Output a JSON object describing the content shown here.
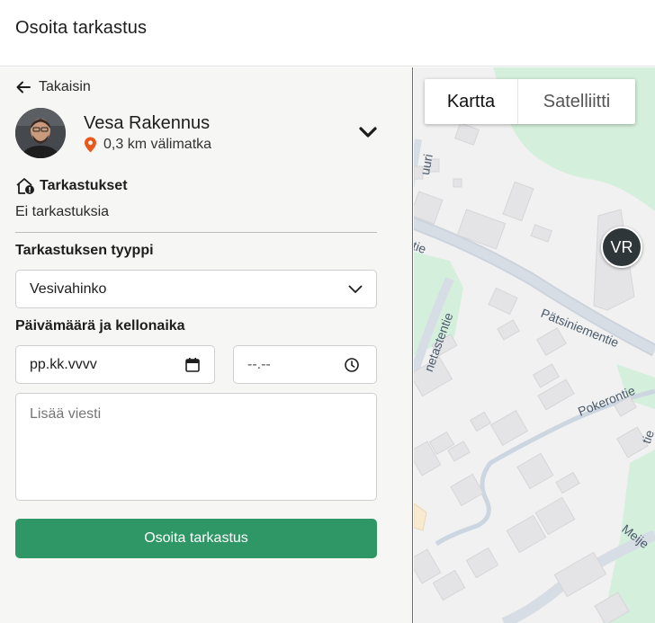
{
  "header": {
    "title": "Osoita tarkastus"
  },
  "back": {
    "label": "Takaisin"
  },
  "person": {
    "name": "Vesa Rakennus",
    "distance": "0,3 km välimatka"
  },
  "inspections": {
    "title": "Tarkastukset",
    "empty_text": "Ei tarkastuksia"
  },
  "form": {
    "type_label": "Tarkastuksen tyyppi",
    "type_value": "Vesivahinko",
    "datetime_label": "Päivämäärä ja kellonaika",
    "date_placeholder": "pp.kk.vvvv",
    "time_placeholder": "--.--",
    "message_placeholder": "Lisää viesti",
    "submit_label": "Osoita tarkastus"
  },
  "map": {
    "tabs": [
      "Kartta",
      "Satelliitti"
    ],
    "marker_initials": "VR",
    "streets": [
      "Pätsiniementie",
      "Pokerontie",
      "Meije",
      "tie",
      "tie",
      "uuri",
      "netastentie"
    ]
  },
  "colors": {
    "accent": "#2e9765",
    "marker": "#2f3639",
    "pin": "#e8581c"
  },
  "icons": [
    "arrow-left-icon",
    "location-pin-icon",
    "chevron-down-icon",
    "home-alert-icon",
    "calendar-icon",
    "clock-icon"
  ]
}
